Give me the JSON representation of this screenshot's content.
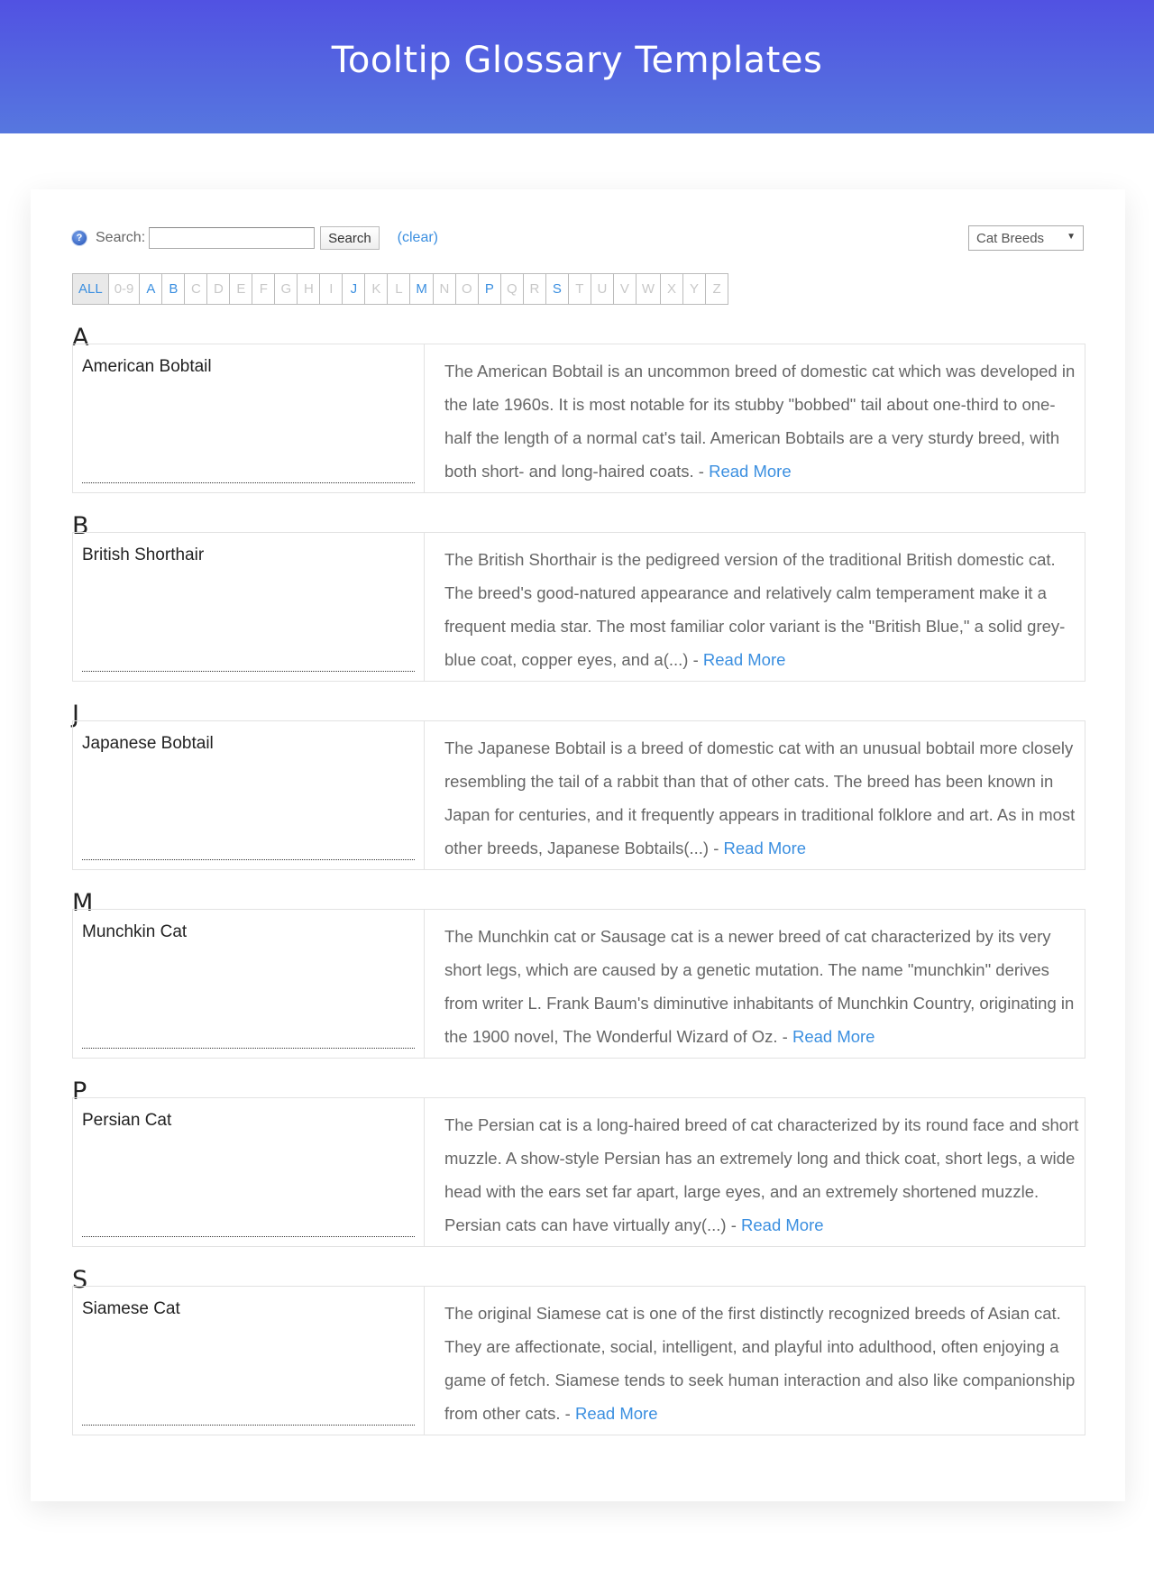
{
  "header": {
    "title": "Tooltip Glossary Templates"
  },
  "search": {
    "help_icon": "help-question-icon",
    "label": "Search:",
    "value": "",
    "placeholder": "",
    "button_label": "Search",
    "clear_label": "(clear)"
  },
  "category_select": {
    "selected": "Cat Breeds",
    "arrow": "▼"
  },
  "alphabet": [
    {
      "label": "ALL",
      "state": "current"
    },
    {
      "label": "0-9",
      "state": "disabled"
    },
    {
      "label": "A",
      "state": "active"
    },
    {
      "label": "B",
      "state": "active"
    },
    {
      "label": "C",
      "state": "disabled"
    },
    {
      "label": "D",
      "state": "disabled"
    },
    {
      "label": "E",
      "state": "disabled"
    },
    {
      "label": "F",
      "state": "disabled"
    },
    {
      "label": "G",
      "state": "disabled"
    },
    {
      "label": "H",
      "state": "disabled"
    },
    {
      "label": "I",
      "state": "disabled"
    },
    {
      "label": "J",
      "state": "active"
    },
    {
      "label": "K",
      "state": "disabled"
    },
    {
      "label": "L",
      "state": "disabled"
    },
    {
      "label": "M",
      "state": "active"
    },
    {
      "label": "N",
      "state": "disabled"
    },
    {
      "label": "O",
      "state": "disabled"
    },
    {
      "label": "P",
      "state": "active"
    },
    {
      "label": "Q",
      "state": "disabled"
    },
    {
      "label": "R",
      "state": "disabled"
    },
    {
      "label": "S",
      "state": "active"
    },
    {
      "label": "T",
      "state": "disabled"
    },
    {
      "label": "U",
      "state": "disabled"
    },
    {
      "label": "V",
      "state": "disabled"
    },
    {
      "label": "W",
      "state": "disabled"
    },
    {
      "label": "X",
      "state": "disabled"
    },
    {
      "label": "Y",
      "state": "disabled"
    },
    {
      "label": "Z",
      "state": "disabled"
    }
  ],
  "read_more_label": "Read More",
  "sections": [
    {
      "letter": "A",
      "term": "American Bobtail",
      "description": "The American Bobtail is an uncommon breed of domestic cat which was developed in the late 1960s. It is most notable for its stubby \"bobbed\" tail about one-third to one-half the length of a normal cat's tail. American Bobtails are a very sturdy breed, with both short- and long-haired coats. - "
    },
    {
      "letter": "B",
      "term": "British Shorthair",
      "description": "The British Shorthair is the pedigreed version of the traditional British domestic cat. The breed's good-natured appearance and relatively calm temperament make it a frequent media star. The most familiar color variant is the \"British Blue,\" a solid grey-blue coat, copper eyes, and a(...) - "
    },
    {
      "letter": "J",
      "term": "Japanese Bobtail",
      "description": "The Japanese Bobtail is a breed of domestic cat with an unusual bobtail more closely resembling the tail of a rabbit than that of other cats. The breed has been known in Japan for centuries, and it frequently appears in traditional folklore and art. As in most other breeds, Japanese Bobtails(...) - "
    },
    {
      "letter": "M",
      "term": "Munchkin Cat",
      "description": "The Munchkin cat or Sausage cat is a newer breed of cat characterized by its very short legs, which are caused by a genetic mutation. The name \"munchkin\" derives from writer L. Frank Baum's diminutive inhabitants of Munchkin Country, originating in the 1900 novel, The Wonderful Wizard of Oz. - "
    },
    {
      "letter": "P",
      "term": "Persian Cat",
      "description": "The Persian cat is a long-haired breed of cat characterized by its round face and short muzzle. A show-style Persian has an extremely long and thick coat, short legs, a wide head with the ears set far apart, large eyes, and an extremely shortened muzzle. Persian cats can have virtually any(...) - "
    },
    {
      "letter": "S",
      "term": "Siamese Cat",
      "description": "The original Siamese cat is one of the first distinctly recognized breeds of Asian cat. They are affectionate, social, intelligent, and playful into adulthood, often enjoying a game of fetch. Siamese tends to seek human interaction and also like companionship from other cats. - "
    }
  ]
}
